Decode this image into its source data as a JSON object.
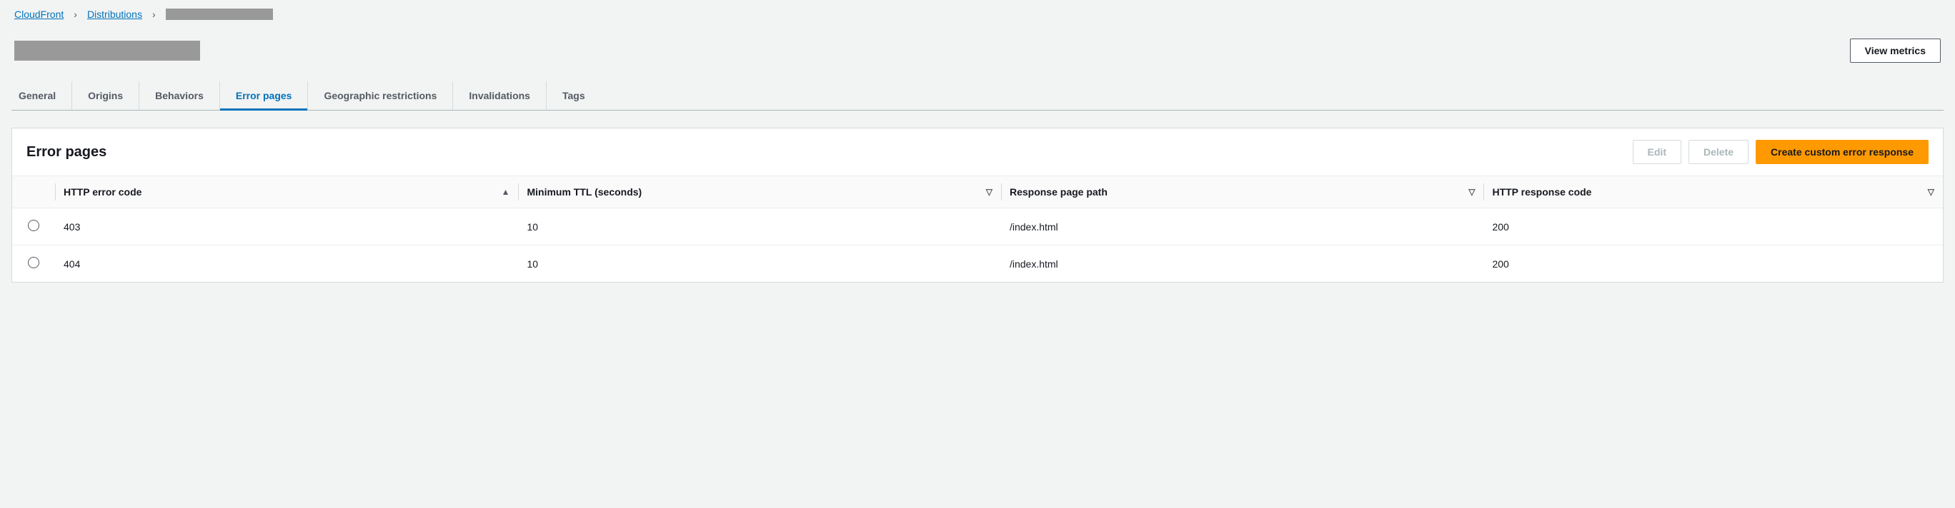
{
  "breadcrumb": {
    "items": [
      {
        "label": "CloudFront",
        "link": true
      },
      {
        "label": "Distributions",
        "link": true
      },
      {
        "label": "",
        "redacted": true
      }
    ]
  },
  "header": {
    "title_redacted": true,
    "view_metrics_label": "View metrics"
  },
  "tabs": [
    {
      "id": "general",
      "label": "General",
      "active": false
    },
    {
      "id": "origins",
      "label": "Origins",
      "active": false
    },
    {
      "id": "behaviors",
      "label": "Behaviors",
      "active": false
    },
    {
      "id": "error-pages",
      "label": "Error pages",
      "active": true
    },
    {
      "id": "geo",
      "label": "Geographic restrictions",
      "active": false
    },
    {
      "id": "invalidations",
      "label": "Invalidations",
      "active": false
    },
    {
      "id": "tags",
      "label": "Tags",
      "active": false
    }
  ],
  "panel": {
    "title": "Error pages",
    "actions": {
      "edit_label": "Edit",
      "edit_disabled": true,
      "delete_label": "Delete",
      "delete_disabled": true,
      "create_label": "Create custom error response"
    },
    "columns": {
      "http_error_code": "HTTP error code",
      "min_ttl": "Minimum TTL (seconds)",
      "response_page_path": "Response page path",
      "http_response_code": "HTTP response code"
    },
    "rows": [
      {
        "http_error_code": "403",
        "min_ttl": "10",
        "response_page_path": "/index.html",
        "http_response_code": "200"
      },
      {
        "http_error_code": "404",
        "min_ttl": "10",
        "response_page_path": "/index.html",
        "http_response_code": "200"
      }
    ]
  }
}
